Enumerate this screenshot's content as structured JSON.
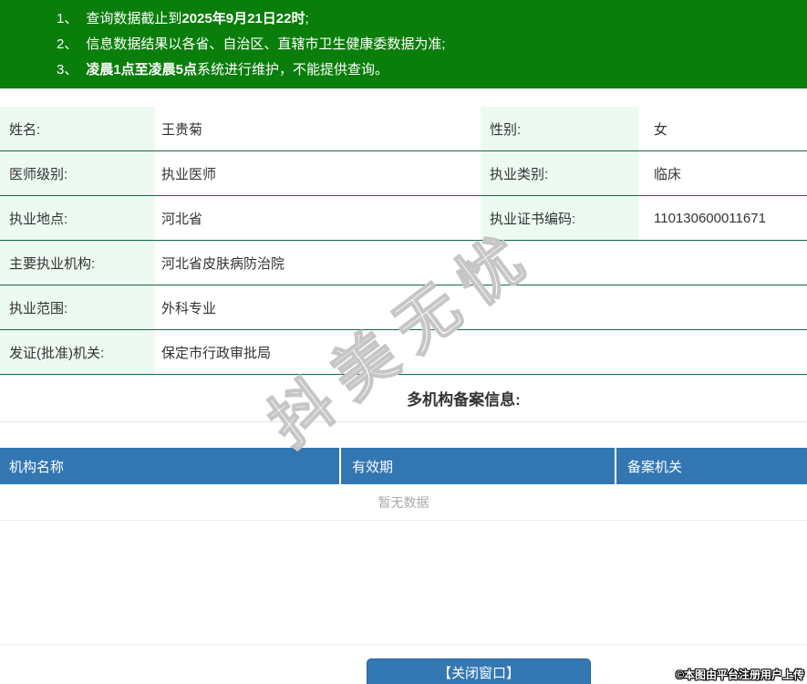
{
  "colors": {
    "banner_green": "#0a7e0a",
    "table_border_green": "#0e6b4c",
    "label_cell_mint": "#ecfaf2",
    "header_blue": "#3377b2",
    "button_blue": "#3478b3",
    "empty_text_gray": "#aaaaaa"
  },
  "notice": {
    "lines": [
      {
        "number": "1、",
        "t1": "查询数据截止到",
        "t2": "2025年9月21日22时",
        "t3": ";"
      },
      {
        "number": "2、",
        "t1": "信息数据结果以各省、自治区、直辖市卫生健康委数据为准;",
        "t2": "",
        "t3": ""
      },
      {
        "number": "3、",
        "t1": "",
        "t2": "凌晨1点至凌晨5点",
        "t3": "系统进行维护，不能提供查询。"
      }
    ]
  },
  "info": {
    "rows2col": [
      {
        "left_label": "姓名:",
        "left_value": "王贵菊",
        "right_label": "性别:",
        "right_value": "女"
      },
      {
        "left_label": "医师级别:",
        "left_value": "执业医师",
        "right_label": "执业类别:",
        "right_value": "临床"
      },
      {
        "left_label": "执业地点:",
        "left_value": "河北省",
        "right_label": "执业证书编码:",
        "right_value": "110130600011671"
      }
    ],
    "rows1col": [
      {
        "label": "主要执业机构:",
        "value": "河北省皮肤病防治院"
      },
      {
        "label": "执业范围:",
        "value": "外科专业"
      },
      {
        "label": "发证(批准)机关:",
        "value": "保定市行政审批局"
      }
    ]
  },
  "filing": {
    "section_title": "多机构备案信息:",
    "columns": [
      "机构名称",
      "有效期",
      "备案机关"
    ],
    "empty_text": "暂无数据"
  },
  "footer": {
    "close_button_label": "【关闭窗口】",
    "credit": "©本图由平台注册用户上传"
  },
  "watermark": {
    "text": "抖美无忧"
  }
}
